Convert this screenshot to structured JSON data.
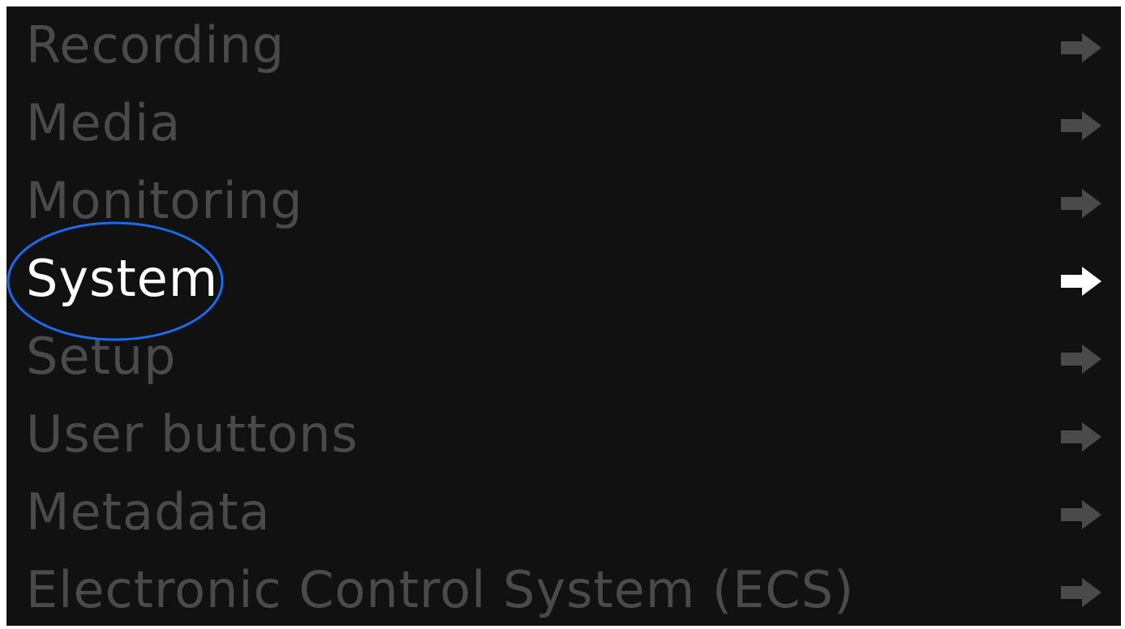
{
  "menu": {
    "items": [
      {
        "label": "Recording",
        "selected": false
      },
      {
        "label": "Media",
        "selected": false
      },
      {
        "label": "Monitoring",
        "selected": false
      },
      {
        "label": "System",
        "selected": true
      },
      {
        "label": "Setup",
        "selected": false
      },
      {
        "label": "User buttons",
        "selected": false
      },
      {
        "label": "Metadata",
        "selected": false
      },
      {
        "label": "Electronic Control System (ECS)",
        "selected": false
      }
    ],
    "item_icon": "right-arrow-icon"
  },
  "colors": {
    "background": "#111111",
    "inactive_item": "#4a4a4a",
    "selected_item": "#ffffff",
    "highlight_ring": "#1a6bf0"
  }
}
